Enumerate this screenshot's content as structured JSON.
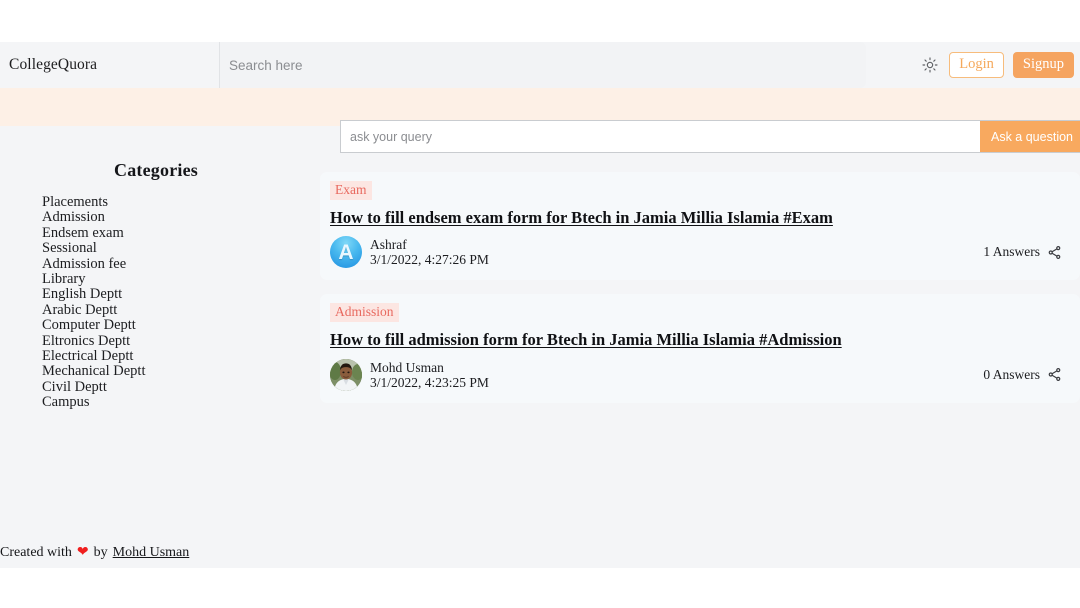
{
  "header": {
    "brand": "CollegeQuora",
    "search_placeholder": "Search here",
    "search_value": "",
    "theme_icon": "sun-icon",
    "login_label": "Login",
    "signup_label": "Signup"
  },
  "ask": {
    "placeholder": "ask your query",
    "value": "",
    "button_label": "Ask a question"
  },
  "sidebar": {
    "title": "Categories",
    "items": [
      {
        "label": "Placements"
      },
      {
        "label": "Admission"
      },
      {
        "label": "Endsem exam"
      },
      {
        "label": "Sessional"
      },
      {
        "label": "Admission fee"
      },
      {
        "label": "Library"
      },
      {
        "label": "English Deptt"
      },
      {
        "label": "Arabic Deptt"
      },
      {
        "label": "Computer Deptt"
      },
      {
        "label": "Eltronics Deptt"
      },
      {
        "label": "Electrical Deptt"
      },
      {
        "label": "Mechanical Deptt"
      },
      {
        "label": "Civil Deptt"
      },
      {
        "label": "Campus"
      }
    ]
  },
  "questions": [
    {
      "tag": "Exam",
      "title": "How to fill endsem exam form for Btech in Jamia Millia Islamia #Exam",
      "author": "Ashraf",
      "date": "3/1/2022, 4:27:26 PM",
      "answers": "1 Answers",
      "avatar_type": "letter",
      "avatar_letter": "A",
      "share_icon": "share-icon"
    },
    {
      "tag": "Admission",
      "title": "How to fill admission form for Btech in Jamia Millia Islamia #Admission",
      "author": "Mohd Usman",
      "date": "3/1/2022, 4:23:25 PM",
      "answers": "0 Answers",
      "avatar_type": "photo",
      "avatar_letter": "",
      "share_icon": "share-icon"
    }
  ],
  "footer": {
    "prefix": "Created with",
    "heart": "❤",
    "middle": "by",
    "author": "Mohd Usman"
  },
  "colors": {
    "accent_orange": "#f5a460",
    "accent_orange_light": "#f7bc7c",
    "tag_text": "#e8695f",
    "tag_bg": "#fce6e2",
    "peach_band": "#fdf0e6",
    "page_bg": "#f4f5f7",
    "card_bg": "#f6f9fb",
    "heart_red": "#f01f1f"
  }
}
